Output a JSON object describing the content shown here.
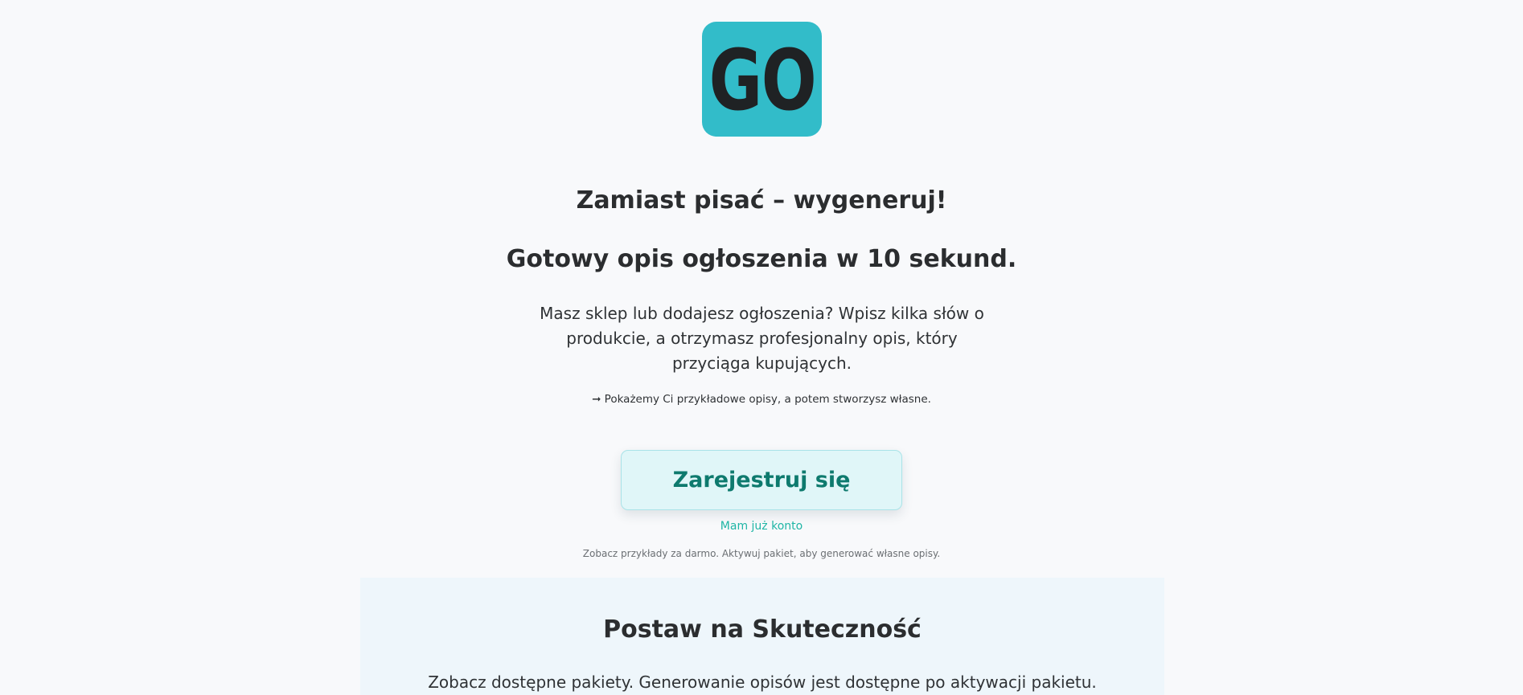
{
  "colors": {
    "logo_bg": "#32bcc9",
    "cta_bg": "#e0f6f8",
    "cta_text": "#0e7a6e",
    "link": "#1fb5a5"
  },
  "logo": {
    "text": "GO"
  },
  "hero": {
    "headline_1": "Zamiast pisać – wygeneruj!",
    "headline_2": "Gotowy opis ogłoszenia w 10 sekund.",
    "lead": "Masz sklep lub dodajesz ogłoszenia? Wpisz kilka słów o produkcie, a otrzymasz profesjonalny opis, który przyciąga kupujących.",
    "hint": "➞ Pokażemy Ci przykładowe opisy, a potem stworzysz własne."
  },
  "cta": {
    "register_label": "Zarejestruj się",
    "login_label": "Mam już konto",
    "note": "Zobacz przykłady za darmo. Aktywuj pakiet, aby generować własne opisy."
  },
  "pricing": {
    "title": "Postaw na Skuteczność",
    "description": "Zobacz dostępne pakiety. Generowanie opisów jest dostępne po aktywacji pakietu."
  }
}
